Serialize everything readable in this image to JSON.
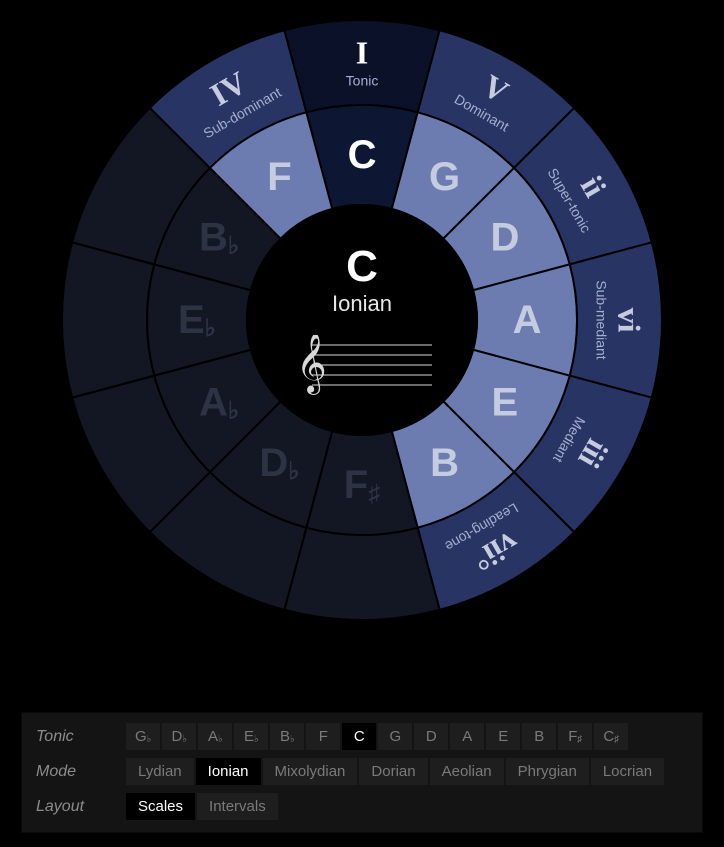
{
  "center": {
    "note": "C",
    "mode": "Ionian"
  },
  "inner_ring": [
    {
      "pos": 0,
      "label": "C",
      "active": true,
      "tonic": true
    },
    {
      "pos": 1,
      "label": "G",
      "active": true
    },
    {
      "pos": 2,
      "label": "D",
      "active": true
    },
    {
      "pos": 3,
      "label": "A",
      "active": true
    },
    {
      "pos": 4,
      "label": "E",
      "active": true
    },
    {
      "pos": 5,
      "label": "B",
      "active": true
    },
    {
      "pos": 6,
      "label": "F♯",
      "active": false
    },
    {
      "pos": 7,
      "label": "D♭",
      "active": false
    },
    {
      "pos": 8,
      "label": "A♭",
      "active": false
    },
    {
      "pos": 9,
      "label": "E♭",
      "active": false
    },
    {
      "pos": 10,
      "label": "B♭",
      "active": false
    },
    {
      "pos": 11,
      "label": "F",
      "active": true
    }
  ],
  "outer_ring": [
    {
      "pos": 0,
      "numeral": "I",
      "function": "Tonic",
      "active": true,
      "tonic": true
    },
    {
      "pos": 1,
      "numeral": "V",
      "function": "Dominant",
      "active": true
    },
    {
      "pos": 2,
      "numeral": "ii",
      "function": "Super-tonic",
      "active": true
    },
    {
      "pos": 3,
      "numeral": "vi",
      "function": "Sub-mediant",
      "active": true
    },
    {
      "pos": 4,
      "numeral": "iii",
      "function": "Mediant",
      "active": true
    },
    {
      "pos": 5,
      "numeral": "vii°",
      "function": "Leading-tone",
      "active": true
    },
    {
      "pos": 6,
      "numeral": "",
      "function": "",
      "active": false
    },
    {
      "pos": 7,
      "numeral": "",
      "function": "",
      "active": false
    },
    {
      "pos": 8,
      "numeral": "",
      "function": "",
      "active": false
    },
    {
      "pos": 9,
      "numeral": "",
      "function": "",
      "active": false
    },
    {
      "pos": 10,
      "numeral": "",
      "function": "",
      "active": false
    },
    {
      "pos": 11,
      "numeral": "IV",
      "function": "Sub-dominant",
      "active": true
    }
  ],
  "controls": {
    "tonic": {
      "label": "Tonic",
      "options": [
        "G♭",
        "D♭",
        "A♭",
        "E♭",
        "B♭",
        "F",
        "C",
        "G",
        "D",
        "A",
        "E",
        "B",
        "F♯",
        "C♯"
      ],
      "selected": "C"
    },
    "mode": {
      "label": "Mode",
      "options": [
        "Lydian",
        "Ionian",
        "Mixolydian",
        "Dorian",
        "Aeolian",
        "Phrygian",
        "Locrian"
      ],
      "selected": "Ionian"
    },
    "layout": {
      "label": "Layout",
      "options": [
        "Scales",
        "Intervals"
      ],
      "selected": "Scales"
    }
  },
  "colors": {
    "wedge_active_inner": "#6d7cb0",
    "wedge_active_outer": "#283463",
    "wedge_tonic_inner": "#0d1733",
    "wedge_tonic_outer": "#0a1129",
    "wedge_inactive": "#131723",
    "stroke": "#000000",
    "text_active": "#c6cce0",
    "text_inactive": "#2e3344",
    "text_tonic": "#ffffff",
    "func_active": "#a5aed0",
    "func_inactive": "#2e3344"
  }
}
